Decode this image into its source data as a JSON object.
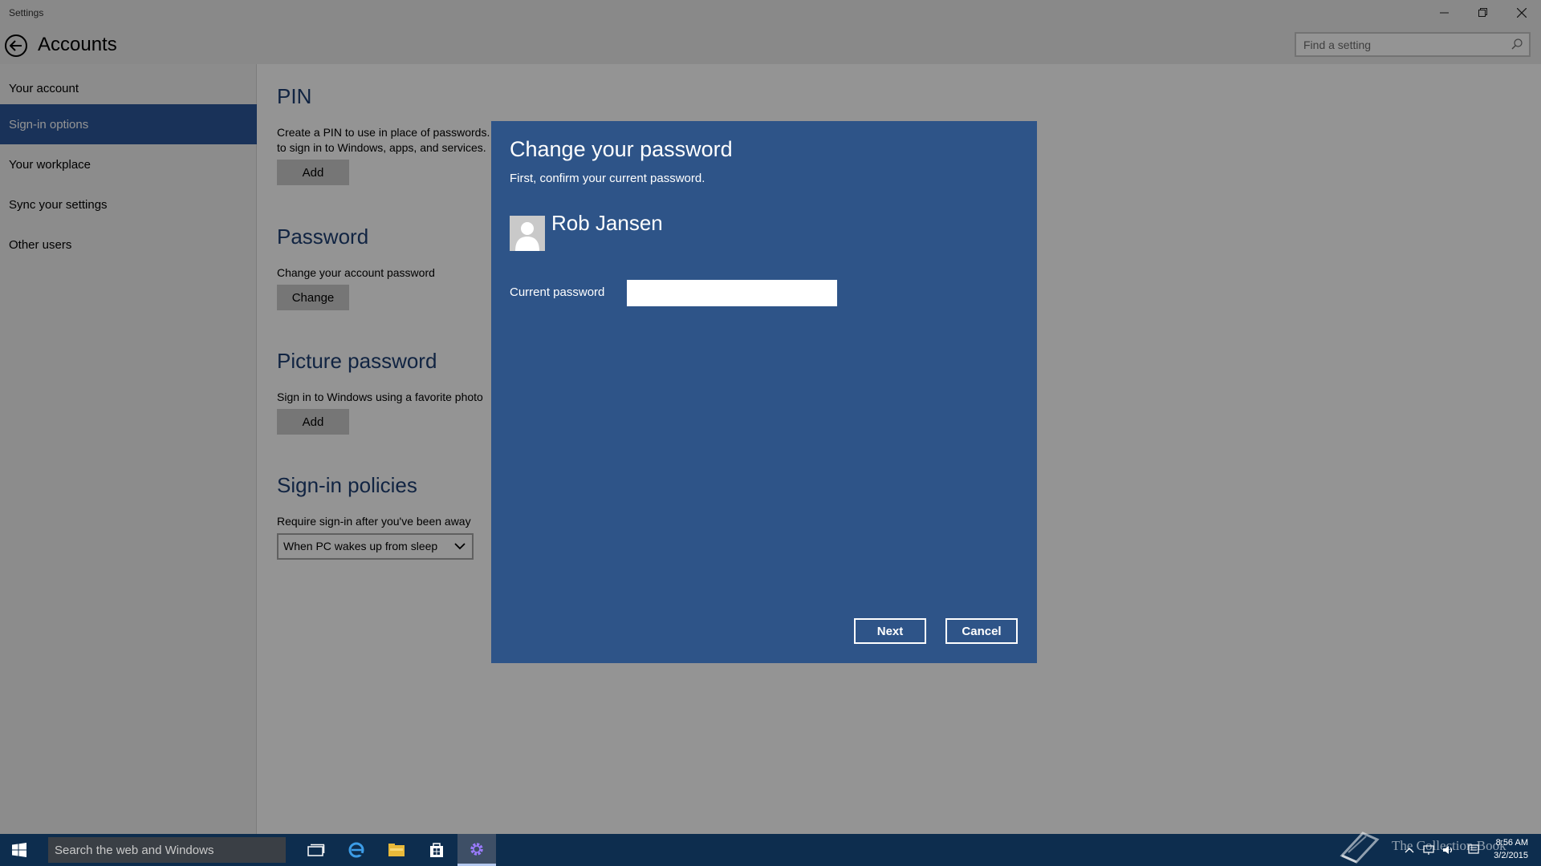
{
  "window": {
    "app_title": "Settings",
    "header_title": "Accounts",
    "search_placeholder": "Find a setting"
  },
  "sidebar": {
    "items": [
      {
        "label": "Your account",
        "active": false
      },
      {
        "label": "Sign-in options",
        "active": true
      },
      {
        "label": "Your workplace",
        "active": false
      },
      {
        "label": "Sync your settings",
        "active": false
      },
      {
        "label": "Other users",
        "active": false
      }
    ]
  },
  "content": {
    "pin": {
      "title": "PIN",
      "text_line1": "Create a PIN to use in place of passwords.",
      "text_line2": "to sign in to Windows, apps, and services.",
      "button": "Add"
    },
    "password": {
      "title": "Password",
      "text": "Change your account password",
      "button": "Change"
    },
    "picture_password": {
      "title": "Picture password",
      "text": "Sign in to Windows using a favorite photo",
      "button": "Add"
    },
    "signin_policies": {
      "title": "Sign-in policies",
      "text": "Require sign-in after you've been away",
      "dropdown_value": "When PC wakes up from sleep"
    }
  },
  "dialog": {
    "title": "Change your password",
    "subtitle": "First, confirm your current password.",
    "user_name": "Rob Jansen",
    "current_password_label": "Current password",
    "current_password_value": "",
    "next_button": "Next",
    "cancel_button": "Cancel",
    "background_color": "#2e5488"
  },
  "taskbar": {
    "search_placeholder": "Search the web and Windows",
    "apps": [
      "task-view",
      "edge",
      "file-explorer",
      "store",
      "settings"
    ],
    "active_app": "settings",
    "clock_time": "8:56 AM",
    "clock_date": "3/2/2015",
    "watermark_text": "The Collection Book"
  },
  "colors": {
    "accent": "#2b579a",
    "section_title": "#1e3f73",
    "taskbar": "#0d2d4e"
  }
}
